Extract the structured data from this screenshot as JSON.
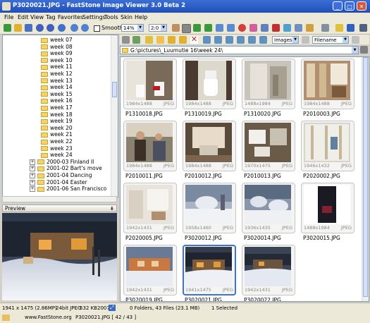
{
  "window": {
    "title": "P3020021.JPG  -  FastStone Image Viewer 3.0 Beta 2"
  },
  "menu": [
    "File",
    "Edit",
    "View",
    "Tag",
    "Favorites",
    "Settings",
    "Tools",
    "Skin",
    "Help"
  ],
  "toolbar": {
    "smooth_label": "Smooth",
    "zoom_value": "14%",
    "ratio_value": "2:0"
  },
  "tree": {
    "items": [
      {
        "label": "week 07",
        "indent": 1
      },
      {
        "label": "week 08",
        "indent": 1
      },
      {
        "label": "week 09",
        "indent": 1
      },
      {
        "label": "week 10",
        "indent": 1
      },
      {
        "label": "week 11",
        "indent": 1
      },
      {
        "label": "week 12",
        "indent": 1
      },
      {
        "label": "week 13",
        "indent": 1
      },
      {
        "label": "week 14",
        "indent": 1
      },
      {
        "label": "week 15",
        "indent": 1
      },
      {
        "label": "week 16",
        "indent": 1
      },
      {
        "label": "week 17",
        "indent": 1
      },
      {
        "label": "week 18",
        "indent": 1
      },
      {
        "label": "week 19",
        "indent": 1
      },
      {
        "label": "week 20",
        "indent": 1
      },
      {
        "label": "week 21",
        "indent": 1
      },
      {
        "label": "week 22",
        "indent": 1
      },
      {
        "label": "week 23",
        "indent": 1
      },
      {
        "label": "week 24",
        "indent": 1
      },
      {
        "label": "2000-03 Finland II",
        "indent": 0
      },
      {
        "label": "2001-02 Bart's move",
        "indent": 0
      },
      {
        "label": "2001-04 Dancing",
        "indent": 0
      },
      {
        "label": "2001-04 Easter",
        "indent": 0
      },
      {
        "label": "2001-06 San Francisco",
        "indent": 0
      }
    ]
  },
  "preview": {
    "label": "Preview"
  },
  "filter": {
    "type_value": "Images",
    "sort_value": "Filename"
  },
  "address": {
    "path": "G:\\pictures\\_Luumutie 16\\week 24\\"
  },
  "thumbnails": [
    {
      "name": "P1310018.JPG",
      "dims": "1984x1488",
      "fmt": "JPEG",
      "scene": "bath"
    },
    {
      "name": "P1310019.JPG",
      "dims": "1984x1488",
      "fmt": "JPEG",
      "scene": "toilet"
    },
    {
      "name": "P1310020.JPG",
      "dims": "1488x1984",
      "fmt": "JPEG",
      "scene": "shower"
    },
    {
      "name": "P2010003.JPG",
      "dims": "1984x1488",
      "fmt": "JPEG",
      "scene": "construction"
    },
    {
      "name": "P2010011.JPG",
      "dims": "1984x1488",
      "fmt": "JPEG",
      "scene": "people"
    },
    {
      "name": "P2010012.JPG",
      "dims": "1984x1488",
      "fmt": "JPEG",
      "scene": "room"
    },
    {
      "name": "P2010013.JPG",
      "dims": "1970x1475",
      "fmt": "JPEG",
      "scene": "room2"
    },
    {
      "name": "P2020002.JPG",
      "dims": "1946x1432",
      "fmt": "JPEG",
      "scene": "frame"
    },
    {
      "name": "P2020005.JPG",
      "dims": "1942x1431",
      "fmt": "JPEG",
      "scene": "bright"
    },
    {
      "name": "P3020012.JPG",
      "dims": "1958x1460",
      "fmt": "JPEG",
      "scene": "snow"
    },
    {
      "name": "P3020014.JPG",
      "dims": "1936x1435",
      "fmt": "JPEG",
      "scene": "snow2"
    },
    {
      "name": "P3020015.JPG",
      "dims": "1488x1984",
      "fmt": "JPEG",
      "scene": "dark"
    },
    {
      "name": "P3020019.JPG",
      "dims": "1942x1431",
      "fmt": "JPEG",
      "scene": "house"
    },
    {
      "name": "P3020021.JPG",
      "dims": "1941x1475",
      "fmt": "JPEG",
      "scene": "housesel",
      "selected": true
    },
    {
      "name": "P3020022.JPG",
      "dims": "1942x1431",
      "fmt": "JPEG",
      "scene": "house3"
    }
  ],
  "status": {
    "dims": "1941 x 1475 (2.86MP)",
    "bits": "24bit JPEG",
    "size": "532 KB",
    "date": "2007",
    "folders": "0 Folders, 43 Files (23.1 MB)",
    "selected": "1 Selected"
  },
  "bottom": {
    "site": "www.FastStone.org",
    "file": "P3020021.JPG [ 42 / 43 ]"
  }
}
